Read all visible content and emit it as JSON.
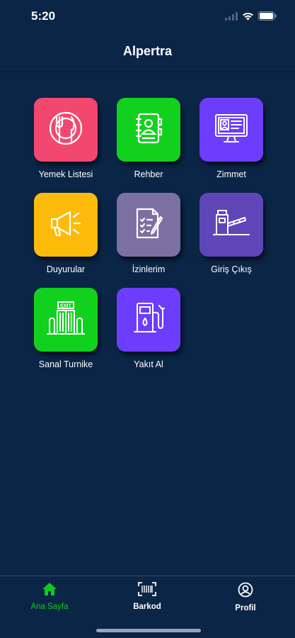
{
  "status_bar": {
    "time": "5:20"
  },
  "header": {
    "title": "Alpertra"
  },
  "tiles": [
    {
      "label": "Yemek Listesi",
      "color": "#f2476f",
      "icon": "plate-cutlery-icon"
    },
    {
      "label": "Rehber",
      "color": "#12d11e",
      "icon": "contact-book-icon"
    },
    {
      "label": "Zimmet",
      "color": "#6d3dfd",
      "icon": "monitor-id-icon"
    },
    {
      "label": "Duyurular",
      "color": "#fcbb0b",
      "icon": "megaphone-icon"
    },
    {
      "label": "İzinlerim",
      "color": "#7b70a2",
      "icon": "document-pen-icon"
    },
    {
      "label": "Giriş Çıkış",
      "color": "#5e46b8",
      "icon": "barrier-gate-icon"
    },
    {
      "label": "Sanal Turnike",
      "color": "#12d11e",
      "icon": "exit-door-icon"
    },
    {
      "label": "Yakıt Al",
      "color": "#6d3dfd",
      "icon": "fuel-pump-icon"
    }
  ],
  "tab_bar": {
    "items": [
      {
        "label": "Ana Sayfa",
        "icon": "home-icon",
        "active": true
      },
      {
        "label": "Barkod",
        "icon": "barcode-icon",
        "active": false
      },
      {
        "label": "Profil",
        "icon": "profile-icon",
        "active": false
      }
    ],
    "active_color": "#12c91f"
  }
}
